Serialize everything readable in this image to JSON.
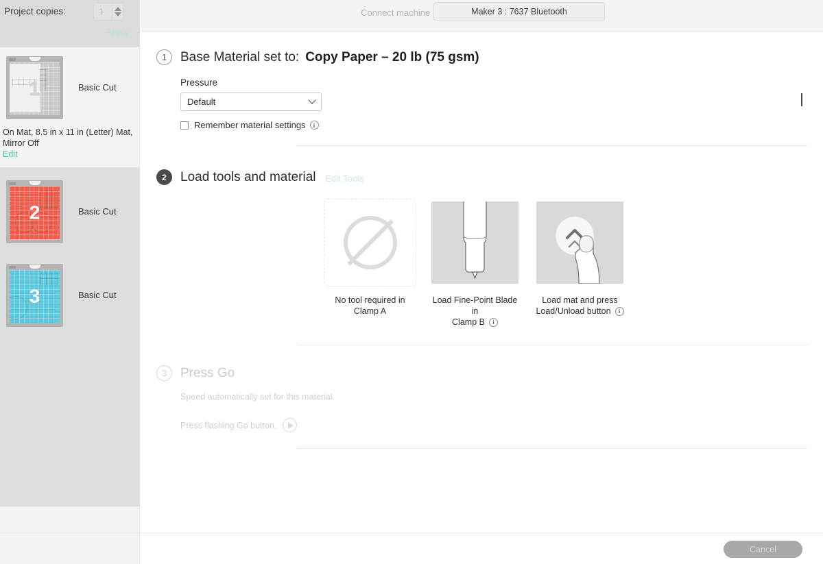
{
  "sidebar": {
    "copies": {
      "label": "Project copies:",
      "value": "1",
      "apply_label": "Apply",
      "stepper_up_icon": "triangle-up-icon",
      "stepper_down_icon": "triangle-down-icon"
    },
    "mats": [
      {
        "number": "1",
        "operation": "Basic Cut",
        "color": "#c9c9c9",
        "selected": true,
        "meta": "On Mat, 8.5 in x 11 in (Letter) Mat, Mirror Off",
        "edit_label": "Edit"
      },
      {
        "number": "2",
        "operation": "Basic Cut",
        "color": "#ef5d4f",
        "selected": false
      },
      {
        "number": "3",
        "operation": "Basic Cut",
        "color": "#5bc8dd",
        "selected": false
      }
    ]
  },
  "topbar": {
    "connect_label": "Connect machine",
    "machine_name": "Maker 3 : 7637 Bluetooth"
  },
  "steps": {
    "step1": {
      "number": "1",
      "title": "Base Material set to:",
      "material": "Copy Paper – 20 lb (75 gsm)",
      "collapse_icon": "chevron-down-icon",
      "pressure_label": "Pressure",
      "pressure_value": "Default",
      "pressure_dropdown_icon": "chevron-down-icon",
      "remember_label": "Remember material settings",
      "remember_checked": false,
      "remember_info_icon": "info-icon"
    },
    "step2": {
      "number": "2",
      "title": "Load tools and material",
      "edit_tools_label": "Edit Tools",
      "cards": [
        {
          "image": "no-tool-icon",
          "caption_line1": "No tool required in",
          "caption_line2": "Clamp A",
          "has_info": false
        },
        {
          "image": "fine-point-blade-icon",
          "caption_line1": "Load Fine-Point Blade in",
          "caption_line2": "Clamp B",
          "has_info": true
        },
        {
          "image": "load-mat-press-icon",
          "caption_line1": "Load mat and press",
          "caption_line2": "Load/Unload button",
          "has_info": true
        }
      ]
    },
    "step3": {
      "number": "3",
      "title": "Press Go",
      "speed_note": "Speed automatically set for this material.",
      "go_text": "Press flashing Go button.",
      "go_icon": "play-icon"
    }
  },
  "footer": {
    "cancel_label": "Cancel"
  },
  "colors": {
    "accent_green": "#4fc59a",
    "mat_red": "#ef5d4f",
    "mat_blue": "#5bc8dd",
    "badge_dark": "#4a4a4a",
    "cancel_bg": "#a8a8a8"
  }
}
